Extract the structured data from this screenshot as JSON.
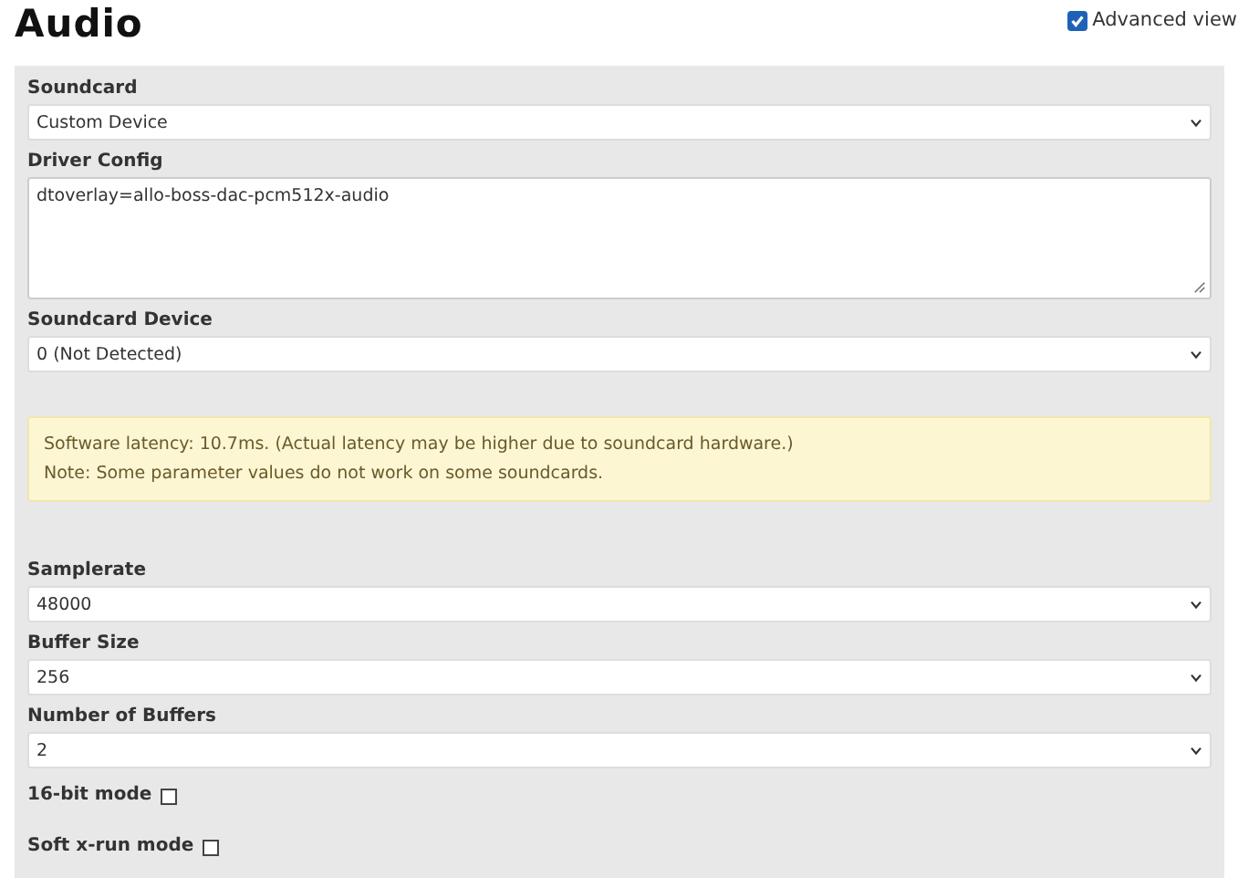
{
  "title": "Audio",
  "advanced_view": {
    "label": "Advanced view",
    "checked": true
  },
  "fields": [
    {
      "kind": "select",
      "label": "Soundcard",
      "value": "Custom Device"
    },
    {
      "kind": "textarea",
      "label": "Driver Config",
      "value": "dtoverlay=allo-boss-dac-pcm512x-audio"
    },
    {
      "kind": "select",
      "label": "Soundcard Device",
      "value": "0 (Not Detected)"
    },
    {
      "kind": "notice",
      "lines": [
        "Software latency: 10.7ms. (Actual latency may be higher due to soundcard hardware.)",
        "Note: Some parameter values do not work on some soundcards."
      ]
    },
    {
      "kind": "select",
      "label": "Samplerate",
      "value": "48000"
    },
    {
      "kind": "select",
      "label": "Buffer Size",
      "value": "256"
    },
    {
      "kind": "select",
      "label": "Number of Buffers",
      "value": "2"
    },
    {
      "kind": "checkbox",
      "label": "16-bit mode",
      "checked": false
    },
    {
      "kind": "checkbox",
      "label": "Soft x-run mode",
      "checked": false
    }
  ]
}
